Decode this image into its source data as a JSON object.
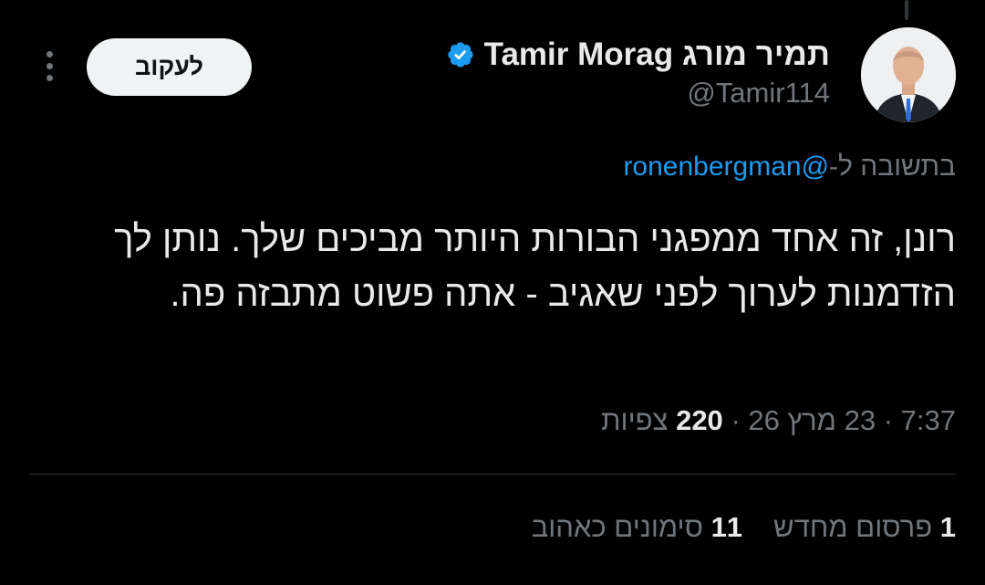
{
  "author": {
    "display_name": "Tamir Morag תמיר מורג",
    "handle": "@Tamir114",
    "verified": true,
    "verified_color": "#1d9bf0"
  },
  "follow_button": {
    "label": "לעקוב"
  },
  "reply_context": {
    "prefix": "בתשובה ל-",
    "mention": "@ronenbergman"
  },
  "tweet": {
    "text": "רונן, זה אחד ממפגני הבורות היותר מביכים שלך. נותן לך הזדמנות לערוך לפני שאגיב - אתה פשוט מתבזה פה."
  },
  "meta": {
    "time": "7:37",
    "separator": "·",
    "date": "23 מרץ 26",
    "views_count": "220",
    "views_label": "צפיות"
  },
  "stats": {
    "reposts_count": "1",
    "reposts_label": "פרסום מחדש",
    "likes_count": "11",
    "likes_label": "סימונים כאהוב"
  },
  "icons": {
    "verified": "verified-badge-icon",
    "more": "more-options-icon"
  },
  "colors": {
    "background": "#000000",
    "text_primary": "#e7e9ea",
    "text_secondary": "#71767b",
    "link": "#1d9bf0",
    "divider": "#2f3336"
  }
}
